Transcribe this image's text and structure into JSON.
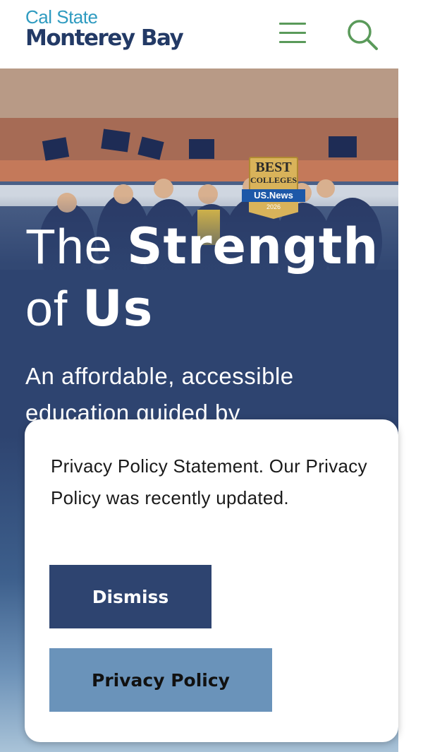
{
  "header": {
    "logo_line1": "Cal State",
    "logo_line2": "Monterey Bay",
    "menu_icon": "hamburger-menu-icon",
    "search_icon": "search-icon"
  },
  "hero": {
    "headline_line1_light": "The ",
    "headline_line1_bold": "Strength",
    "headline_line2_light": "of ",
    "headline_line2_bold": "Us",
    "subtitle": "An affordable, accessible education guided by",
    "badge": {
      "best": "BEST",
      "colleges": "COLLEGES",
      "brand": "US.News",
      "year": "2026"
    }
  },
  "privacy_modal": {
    "message": "Privacy Policy Statement. Our Privacy Policy was recently updated.",
    "dismiss_label": "Dismiss",
    "policy_label": "Privacy Policy"
  },
  "colors": {
    "navy": "#2e4470",
    "logo_blue": "#2f9bc0",
    "logo_navy": "#233a66",
    "icon_green": "#5a9a5a",
    "policy_button": "#6a93ba"
  }
}
